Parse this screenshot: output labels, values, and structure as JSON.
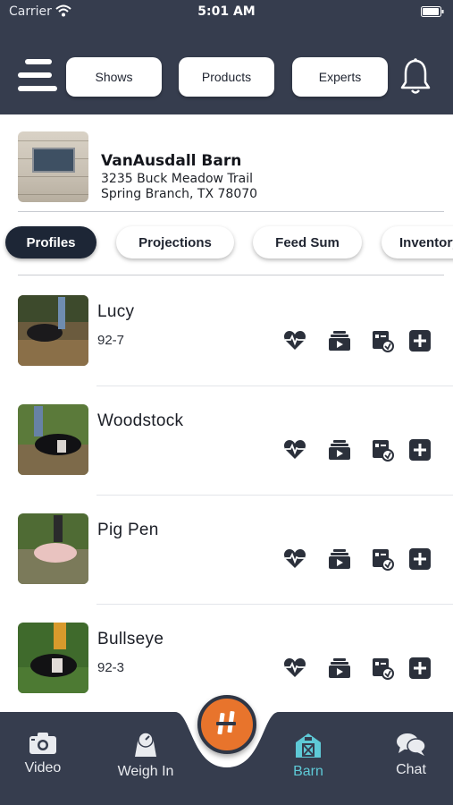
{
  "status_bar": {
    "carrier": "Carrier",
    "time": "5:01 AM"
  },
  "header": {
    "nav_buttons": [
      {
        "label": "Shows"
      },
      {
        "label": "Products"
      },
      {
        "label": "Experts"
      }
    ],
    "menu_icon": "hamburger-menu-icon",
    "bell_icon": "bell-icon"
  },
  "barn": {
    "name": "VanAusdall Barn",
    "address_line1": "3235 Buck Meadow Trail",
    "address_line2": "Spring Branch, TX 78070"
  },
  "tabs": [
    {
      "label": "Profiles",
      "active": true
    },
    {
      "label": "Projections",
      "active": false
    },
    {
      "label": "Feed Sum",
      "active": false
    },
    {
      "label": "Inventory",
      "active": false
    }
  ],
  "animals": [
    {
      "name": "Lucy",
      "tag": "92-7"
    },
    {
      "name": "Woodstock",
      "tag": ""
    },
    {
      "name": "Pig Pen",
      "tag": ""
    },
    {
      "name": "Bullseye",
      "tag": "92-3"
    }
  ],
  "row_actions": [
    "heart-pulse-icon",
    "media-stack-icon",
    "feed-log-icon",
    "add-icon"
  ],
  "bottom_nav": {
    "items": [
      {
        "label": "Video",
        "icon": "camera-icon"
      },
      {
        "label": "Weigh In",
        "icon": "scale-icon"
      },
      {
        "label": "Barn",
        "icon": "barn-icon",
        "active": true
      },
      {
        "label": "Chat",
        "icon": "chat-bubbles-icon"
      }
    ],
    "center_button_icon": "logo-icon"
  },
  "colors": {
    "header_bg": "#363d4e",
    "active_tab": "#1d2636",
    "accent_orange": "#e8742c",
    "active_nav": "#5ec9d6"
  }
}
